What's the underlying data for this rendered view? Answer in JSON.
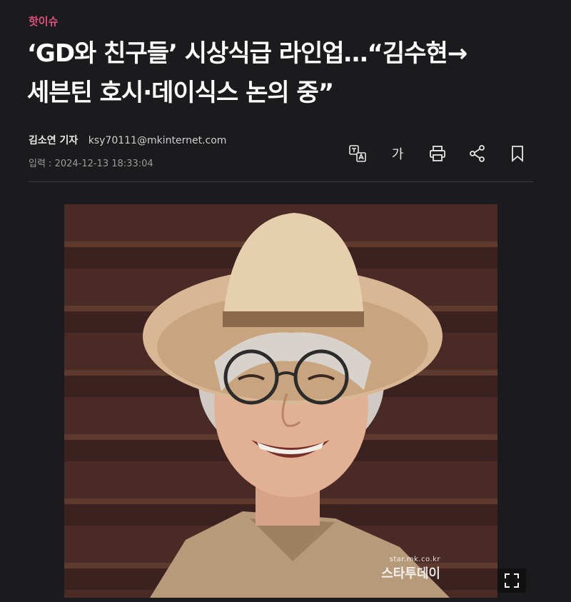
{
  "category": "핫이슈",
  "headline": {
    "line1": "‘GD와 친구들’ 시상식급 라인업…“김수현→",
    "line2": "세븐틴 호시·데이식스 논의 중”"
  },
  "byline": {
    "author": "김소연 기자",
    "email": "ksy70111@mkinternet.com"
  },
  "date": "입력 : 2024-12-13 18:33:04",
  "tools": {
    "font_size_label": "가",
    "icons": [
      "translate-icon",
      "font-size-icon",
      "print-icon",
      "share-icon",
      "bookmark-icon"
    ]
  },
  "photo": {
    "watermark_domain": "star.mk.co.kr",
    "watermark_name": "스타투데이"
  },
  "colors": {
    "background": "#1b1b1d",
    "category": "#e0507e",
    "text": "#ffffff",
    "meta": "#9a9a9a"
  }
}
